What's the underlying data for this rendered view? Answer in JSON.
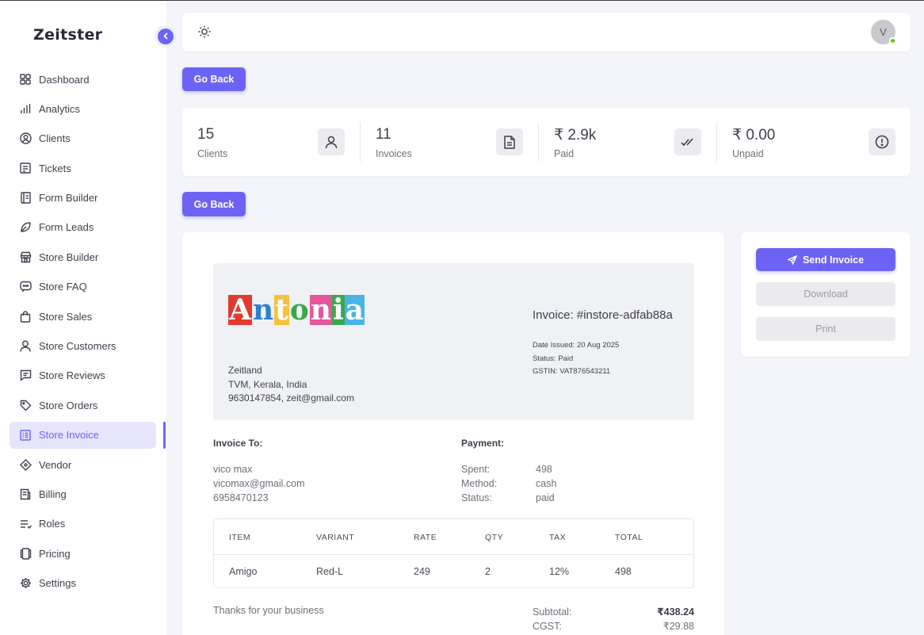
{
  "app": {
    "logo": "Zeitster"
  },
  "sidebar": {
    "items": [
      {
        "label": "Dashboard",
        "icon": "dashboard-icon"
      },
      {
        "label": "Analytics",
        "icon": "bar-chart-icon"
      },
      {
        "label": "Clients",
        "icon": "user-circle-icon"
      },
      {
        "label": "Tickets",
        "icon": "ticket-icon"
      },
      {
        "label": "Form Builder",
        "icon": "form-icon"
      },
      {
        "label": "Form Leads",
        "icon": "leaf-icon"
      },
      {
        "label": "Store Builder",
        "icon": "store-icon"
      },
      {
        "label": "Store FAQ",
        "icon": "chat-icon"
      },
      {
        "label": "Store Sales",
        "icon": "bag-icon"
      },
      {
        "label": "Store Customers",
        "icon": "user-icon"
      },
      {
        "label": "Store Reviews",
        "icon": "review-icon"
      },
      {
        "label": "Store Orders",
        "icon": "tag-icon"
      },
      {
        "label": "Store Invoice",
        "icon": "invoice-icon",
        "active": true
      },
      {
        "label": "Vendor",
        "icon": "vendor-icon"
      },
      {
        "label": "Billing",
        "icon": "billing-icon"
      },
      {
        "label": "Roles",
        "icon": "roles-icon"
      },
      {
        "label": "Pricing",
        "icon": "pricing-icon"
      },
      {
        "label": "Settings",
        "icon": "gear-icon"
      }
    ],
    "accent": "#6c63f5"
  },
  "topbar": {
    "avatar_initial": "V"
  },
  "buttons": {
    "go_back": "Go Back",
    "send_invoice": "Send Invoice",
    "download": "Download",
    "print": "Print"
  },
  "stats": [
    {
      "value": "15",
      "label": "Clients",
      "icon": "user-icon"
    },
    {
      "value": "11",
      "label": "Invoices",
      "icon": "document-icon"
    },
    {
      "value": "₹ 2.9k",
      "label": "Paid",
      "icon": "double-check-icon"
    },
    {
      "value": "₹ 0.00",
      "label": "Unpaid",
      "icon": "alert-circle-icon"
    }
  ],
  "invoice": {
    "brand_letters": [
      "A",
      "n",
      "t",
      "o",
      "n",
      "i",
      "a"
    ],
    "company": {
      "name": "Zeitland",
      "address": "TVM, Kerala, India",
      "contact": "9630147854, zeit@gmail.com"
    },
    "title": "Invoice: #instore-adfab88a",
    "date_issued": "Date Issued: 20 Aug 2025",
    "status": "Status: Paid",
    "gstin": "GSTIN: VAT876543211",
    "to_title": "Invoice To:",
    "to": {
      "name": "vico max",
      "email": "vicomax@gmail.com",
      "phone": "6958470123"
    },
    "payment_title": "Payment:",
    "payment": {
      "spent_label": "Spent:",
      "spent": "498",
      "method_label": "Method:",
      "method": "cash",
      "status_label": "Status:",
      "status": "paid"
    },
    "table": {
      "headers": [
        "ITEM",
        "VARIANT",
        "RATE",
        "QTY",
        "TAX",
        "TOTAL"
      ],
      "rows": [
        [
          "Amigo",
          "Red-L",
          "249",
          "2",
          "12%",
          "498"
        ]
      ]
    },
    "thanks": "Thanks for your business",
    "totals": {
      "subtotal_label": "Subtotal:",
      "subtotal": "₹438.24",
      "cgst_label": "CGST:",
      "cgst": "₹29.88"
    }
  }
}
